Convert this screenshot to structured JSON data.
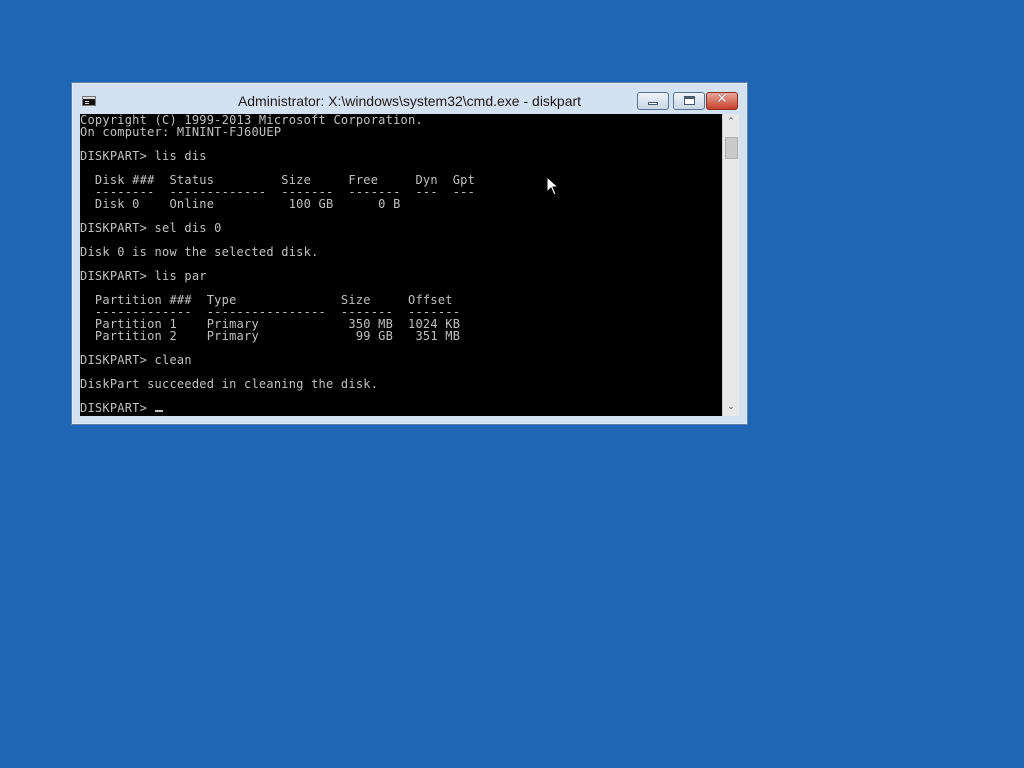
{
  "window": {
    "title": "Administrator: X:\\windows\\system32\\cmd.exe - diskpart",
    "icons": {
      "app": "cmd-icon",
      "minimize": "minimize-icon",
      "maximize": "maximize-icon",
      "close": "close-icon"
    },
    "close_glyph": "✕"
  },
  "console": {
    "lines": [
      "Copyright (C) 1999-2013 Microsoft Corporation.",
      "On computer: MININT-FJ60UEP",
      "",
      "DISKPART> lis dis",
      "",
      "  Disk ###  Status         Size     Free     Dyn  Gpt",
      "  --------  -------------  -------  -------  ---  ---",
      "  Disk 0    Online          100 GB      0 B",
      "",
      "DISKPART> sel dis 0",
      "",
      "Disk 0 is now the selected disk.",
      "",
      "DISKPART> lis par",
      "",
      "  Partition ###  Type              Size     Offset",
      "  -------------  ----------------  -------  -------",
      "  Partition 1    Primary            350 MB  1024 KB",
      "  Partition 2    Primary             99 GB   351 MB",
      "",
      "DISKPART> clean",
      "",
      "DiskPart succeeded in cleaning the disk.",
      "",
      "DISKPART> "
    ]
  },
  "scrollbar": {
    "up_arrow": "⌃",
    "down_arrow": "⌄"
  },
  "colors": {
    "desktop": "#1f66b4",
    "console_bg": "#000000",
    "console_fg": "#c0c0c0",
    "close_button": "#c7412b"
  }
}
